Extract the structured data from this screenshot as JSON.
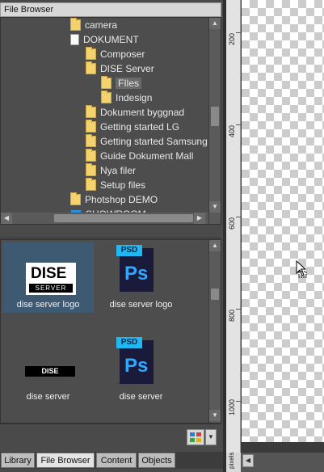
{
  "panel": {
    "title": "File Browser"
  },
  "tree": {
    "items": [
      {
        "label": "camera",
        "icon": "folder-icon"
      },
      {
        "label": "DOKUMENT",
        "icon": "document-icon"
      },
      {
        "label": "Composer",
        "icon": "folder-icon"
      },
      {
        "label": "DISE Server",
        "icon": "folder-icon"
      },
      {
        "label": "FIles",
        "icon": "folder-icon"
      },
      {
        "label": "Indesign",
        "icon": "folder-icon"
      },
      {
        "label": "Dokument byggnad",
        "icon": "folder-icon"
      },
      {
        "label": "Getting started LG",
        "icon": "folder-icon"
      },
      {
        "label": "Getting started Samsung",
        "icon": "folder-icon"
      },
      {
        "label": "Guide Dokument Mall",
        "icon": "folder-icon"
      },
      {
        "label": "Nya filer",
        "icon": "folder-icon"
      },
      {
        "label": "Setup files",
        "icon": "folder-icon"
      },
      {
        "label": "Photshop DEMO",
        "icon": "folder-icon"
      },
      {
        "label": "SHOWROOM",
        "icon": "showroom-icon"
      }
    ]
  },
  "content": {
    "items": [
      {
        "caption": "dise server logo",
        "thumb": "dise-logo"
      },
      {
        "caption": "dise server logo",
        "thumb": "psd-file"
      },
      {
        "caption": "dise server",
        "thumb": "dise-small"
      },
      {
        "caption": "dise server",
        "thumb": "psd-file"
      }
    ],
    "dise_text": "DISE",
    "server_text": "SERVER",
    "psd_tag": "PSD",
    "ps_text": "Ps"
  },
  "tabs": [
    {
      "label": "Library"
    },
    {
      "label": "File Browser"
    },
    {
      "label": "Content"
    },
    {
      "label": "Objects"
    }
  ],
  "ruler": {
    "labels": [
      "200",
      "400",
      "600",
      "800",
      "1000"
    ],
    "units": "pixels"
  },
  "colors": {
    "selection": "#3e5a72",
    "folder": "#f4d36f",
    "psd_accent": "#31a8ff"
  }
}
